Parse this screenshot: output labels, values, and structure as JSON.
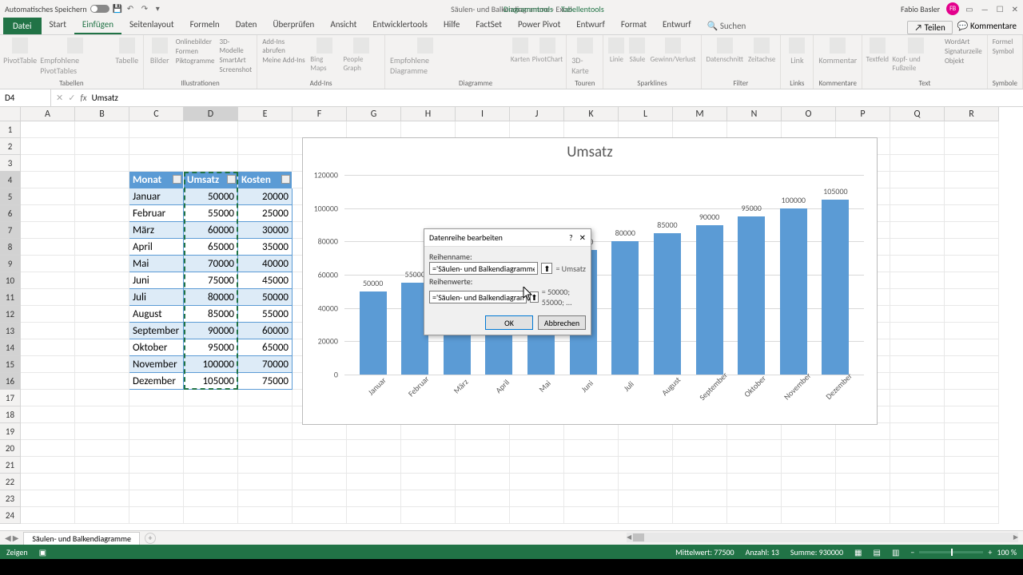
{
  "titlebar": {
    "autosave_label": "Automatisches Speichern",
    "doc_title": "Säulen- und Balkendiagramme - Excel",
    "tool_tabs": [
      "Diagrammtools",
      "Tabellentools"
    ],
    "user_name": "Fabio Basler",
    "user_initials": "FB"
  },
  "tabs": {
    "file": "Datei",
    "items": [
      "Start",
      "Einfügen",
      "Seitenlayout",
      "Formeln",
      "Daten",
      "Überprüfen",
      "Ansicht",
      "Entwicklertools",
      "Hilfe",
      "FactSet",
      "Power Pivot",
      "Entwurf",
      "Format",
      "Entwurf"
    ],
    "active_index": 1,
    "search": "Suchen",
    "share": "Teilen",
    "comments": "Kommentare"
  },
  "ribbon_groups": [
    "Tabellen",
    "Illustrationen",
    "Add-Ins",
    "Diagramme",
    "Touren",
    "Sparklines",
    "Filter",
    "Links",
    "Kommentare",
    "Text",
    "Symbole"
  ],
  "ribbon": {
    "pivot": "PivotTable",
    "pivot_rec": "Empfohlene PivotTables",
    "tabelle": "Tabelle",
    "bilder": "Bilder",
    "onlinebilder": "Onlinebilder",
    "formen": "Formen",
    "piktogramme": "Piktogramme",
    "models3d": "3D-Modelle",
    "smartart": "SmartArt",
    "screenshot": "Screenshot",
    "addins_get": "Add-Ins abrufen",
    "addins_mine": "Meine Add-Ins",
    "bing": "Bing Maps",
    "people": "People Graph",
    "rec_charts": "Empfohlene Diagramme",
    "maps": "Karten",
    "pivotchart": "PivotChart",
    "map3d": "3D-Karte",
    "spark_line": "Linie",
    "spark_col": "Säule",
    "spark_wl": "Gewinn/Verlust",
    "slicer": "Datenschnitt",
    "timeline": "Zeitachse",
    "link": "Link",
    "comment": "Kommentar",
    "textfield": "Textfeld",
    "headerfooter": "Kopf- und Fußzeile",
    "wordart": "WordArt",
    "sigline": "Signaturzeile",
    "object": "Objekt",
    "equation": "Formel",
    "symbol": "Symbol"
  },
  "name_box": "D4",
  "formula": "Umsatz",
  "columns": [
    "A",
    "B",
    "C",
    "D",
    "E",
    "F",
    "G",
    "H",
    "I",
    "J",
    "K",
    "L",
    "M",
    "N",
    "O",
    "P",
    "Q",
    "R"
  ],
  "rows": [
    1,
    2,
    3,
    4,
    5,
    6,
    7,
    8,
    9,
    10,
    11,
    12,
    13,
    14,
    15,
    16,
    17,
    18,
    19,
    20,
    21,
    22,
    23,
    24
  ],
  "table": {
    "headers": [
      "Monat",
      "Umsatz",
      "Kosten"
    ],
    "rows": [
      [
        "Januar",
        50000,
        20000
      ],
      [
        "Februar",
        55000,
        25000
      ],
      [
        "März",
        60000,
        30000
      ],
      [
        "April",
        65000,
        35000
      ],
      [
        "Mai",
        70000,
        40000
      ],
      [
        "Juni",
        75000,
        45000
      ],
      [
        "Juli",
        80000,
        50000
      ],
      [
        "August",
        85000,
        55000
      ],
      [
        "September",
        90000,
        60000
      ],
      [
        "Oktober",
        95000,
        65000
      ],
      [
        "November",
        100000,
        70000
      ],
      [
        "Dezember",
        105000,
        75000
      ]
    ]
  },
  "chart_data": {
    "type": "bar",
    "title": "Umsatz",
    "categories": [
      "Januar",
      "Februar",
      "März",
      "April",
      "Mai",
      "Juni",
      "Juli",
      "August",
      "September",
      "Oktober",
      "November",
      "Dezember"
    ],
    "values": [
      50000,
      55000,
      60000,
      65000,
      70000,
      75000,
      80000,
      85000,
      90000,
      95000,
      100000,
      105000
    ],
    "ylim": [
      0,
      120000
    ],
    "yticks": [
      0,
      20000,
      40000,
      60000,
      80000,
      100000,
      120000
    ],
    "xlabel": "",
    "ylabel": ""
  },
  "dialog": {
    "title": "Datenreihe bearbeiten",
    "name_label": "Reihenname:",
    "name_value": "='Säulen- und Balkendiagramme'",
    "name_result": "= Umsatz",
    "values_label": "Reihenwerte:",
    "values_value": "='Säulen- und Balkendiagramme'",
    "values_result": "= 50000; 55000; ...",
    "ok": "OK",
    "cancel": "Abbrechen"
  },
  "sheet_tab": "Säulen- und Balkendiagramme",
  "status": {
    "mode": "Zeigen",
    "avg": "Mittelwert: 77500",
    "count": "Anzahl: 13",
    "sum": "Summe: 930000",
    "zoom": "100 %"
  }
}
